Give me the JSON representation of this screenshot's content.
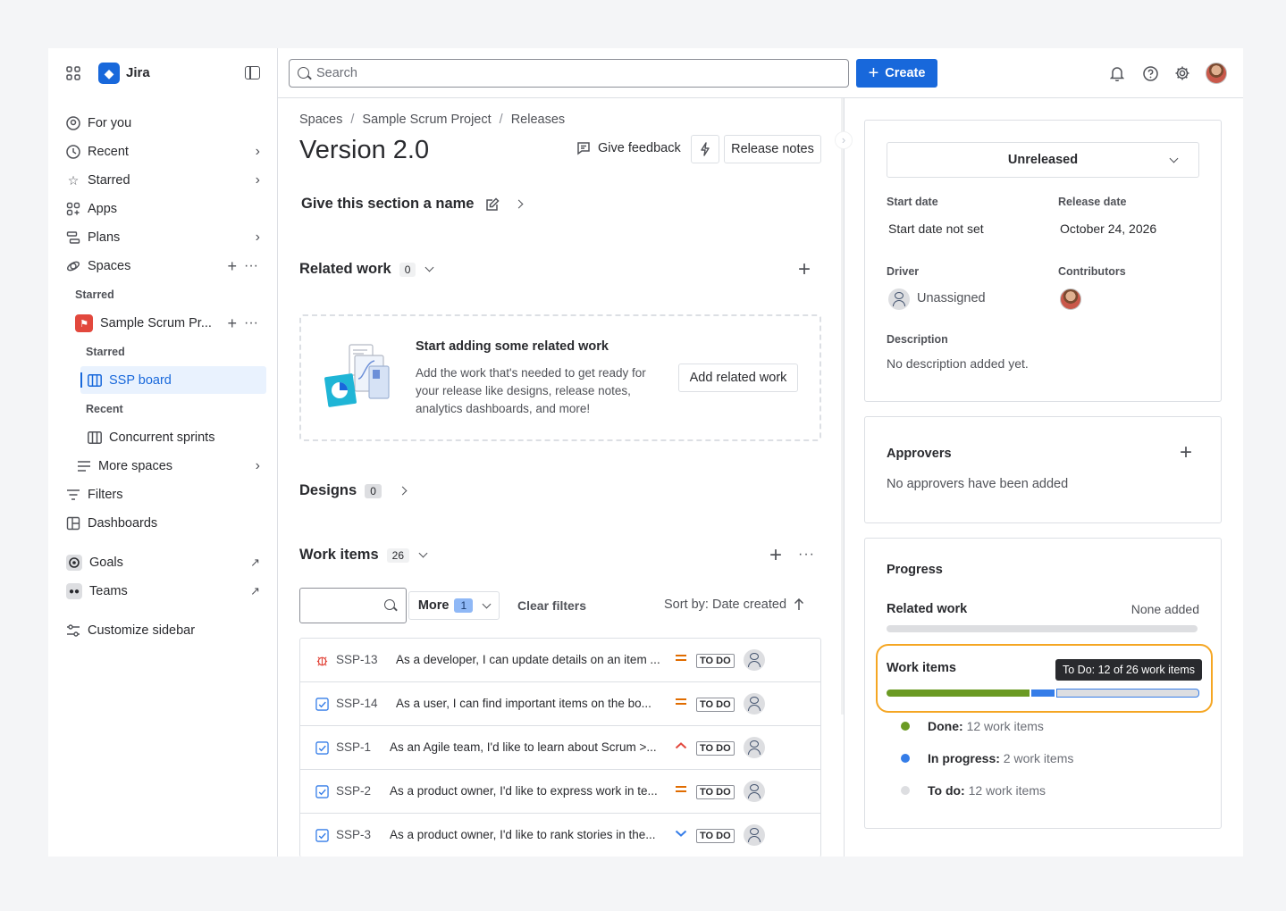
{
  "app": {
    "name": "Jira"
  },
  "sidebar": {
    "items": [
      {
        "label": "For you"
      },
      {
        "label": "Recent"
      },
      {
        "label": "Starred"
      },
      {
        "label": "Apps"
      },
      {
        "label": "Plans"
      },
      {
        "label": "Spaces"
      }
    ],
    "starred_section": "Starred",
    "project_name": "Sample Scrum Pr...",
    "project_starred_section": "Starred",
    "board": "SSP board",
    "recent_section": "Recent",
    "recent_item": "Concurrent sprints",
    "more_spaces": "More spaces",
    "filters": "Filters",
    "dashboards": "Dashboards",
    "goals": "Goals",
    "teams": "Teams",
    "customize": "Customize sidebar"
  },
  "topbar": {
    "search_placeholder": "Search",
    "create_label": "Create"
  },
  "breadcrumb": [
    "Spaces",
    "Sample Scrum Project",
    "Releases"
  ],
  "page": {
    "title": "Version 2.0",
    "give_feedback": "Give feedback",
    "release_notes": "Release notes",
    "section_name": "Give this section a name"
  },
  "related_work": {
    "title": "Related work",
    "count": "0",
    "empty_title": "Start adding some related work",
    "empty_desc": "Add the work that's needed to get ready for your release like designs, release notes, analytics dashboards, and more!",
    "add_button": "Add related work"
  },
  "designs": {
    "title": "Designs",
    "count": "0"
  },
  "work_items": {
    "title": "Work items",
    "count": "26",
    "more_label": "More",
    "more_count": "1",
    "clear_filters": "Clear filters",
    "sort_label": "Sort by: Date created",
    "rows": [
      {
        "type": "bug",
        "key": "SSP-13",
        "summary": "As a developer, I can update details on an item ...",
        "priority": "medium",
        "status": "TO DO"
      },
      {
        "type": "story",
        "key": "SSP-14",
        "summary": "As a user, I can find important items on the bo...",
        "priority": "medium",
        "status": "TO DO"
      },
      {
        "type": "story",
        "key": "SSP-1",
        "summary": "As an Agile team, I'd like to learn about Scrum >...",
        "priority": "high",
        "status": "TO DO"
      },
      {
        "type": "story",
        "key": "SSP-2",
        "summary": "As a product owner, I'd like to express work in te...",
        "priority": "medium",
        "status": "TO DO"
      },
      {
        "type": "story",
        "key": "SSP-3",
        "summary": "As a product owner, I'd like to rank stories in the...",
        "priority": "low",
        "status": "TO DO"
      }
    ]
  },
  "details": {
    "status": "Unreleased",
    "start_date_label": "Start date",
    "start_date_value": "Start date not set",
    "release_date_label": "Release date",
    "release_date_value": "October 24, 2026",
    "driver_label": "Driver",
    "driver_value": "Unassigned",
    "contributors_label": "Contributors",
    "description_label": "Description",
    "description_value": "No description added yet."
  },
  "approvers": {
    "title": "Approvers",
    "empty": "No approvers have been added"
  },
  "progress": {
    "title": "Progress",
    "related_work_label": "Related work",
    "related_work_value": "None added",
    "work_items_label": "Work items",
    "tooltip": "To Do: 12 of 26 work items",
    "total": 26,
    "done": 12,
    "in_progress": 2,
    "to_do": 12,
    "legend": [
      {
        "label": "Done:",
        "value": "12 work items",
        "color": "#6a9a23"
      },
      {
        "label": "In progress:",
        "value": "2 work items",
        "color": "#357de8"
      },
      {
        "label": "To do:",
        "value": "12 work items",
        "color": "#dddee1"
      }
    ]
  }
}
